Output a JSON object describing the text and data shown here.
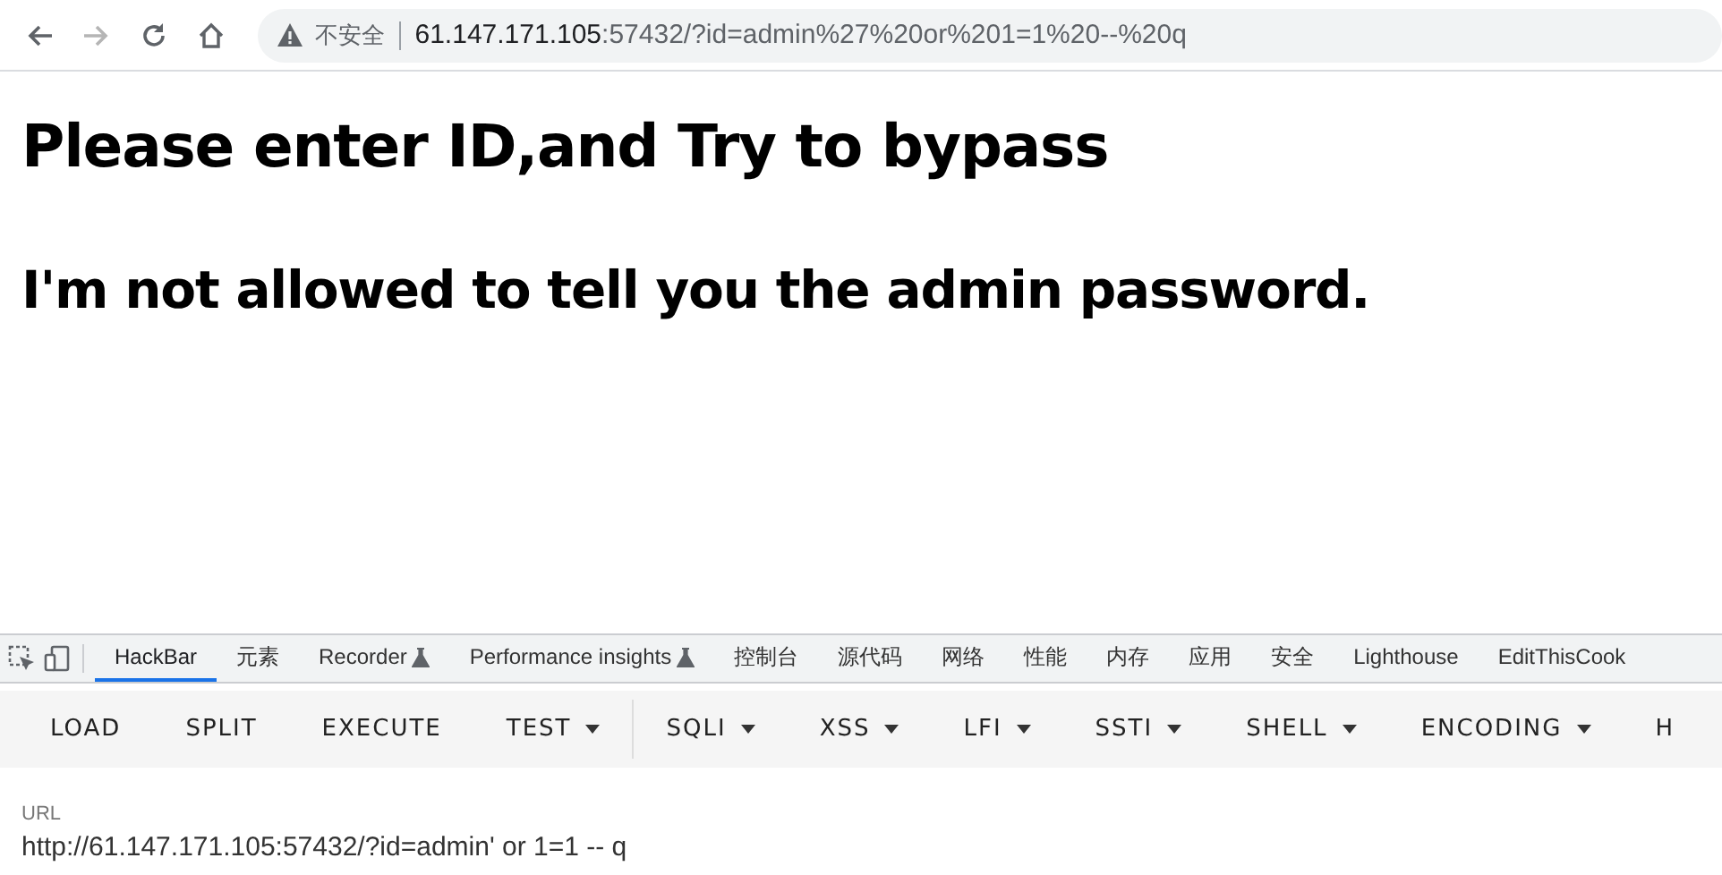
{
  "browser": {
    "security_label": "不安全",
    "url_host": "61.147.171.105",
    "url_rest": ":57432/?id=admin%27%20or%201=1%20--%20q"
  },
  "page": {
    "headings": [
      {
        "kind": "title",
        "text": "Please enter ID,and Try to bypass"
      },
      {
        "kind": "subtitle",
        "text": "I'm not allowed to tell you the admin password."
      }
    ]
  },
  "devtools": {
    "tabs": [
      {
        "label": "HackBar",
        "selected": true,
        "flask": false
      },
      {
        "label": "元素",
        "selected": false,
        "flask": false
      },
      {
        "label": "Recorder",
        "selected": false,
        "flask": true
      },
      {
        "label": "Performance insights",
        "selected": false,
        "flask": true
      },
      {
        "label": "控制台",
        "selected": false,
        "flask": false
      },
      {
        "label": "源代码",
        "selected": false,
        "flask": false
      },
      {
        "label": "网络",
        "selected": false,
        "flask": false
      },
      {
        "label": "性能",
        "selected": false,
        "flask": false
      },
      {
        "label": "内存",
        "selected": false,
        "flask": false
      },
      {
        "label": "应用",
        "selected": false,
        "flask": false
      },
      {
        "label": "安全",
        "selected": false,
        "flask": false
      },
      {
        "label": "Lighthouse",
        "selected": false,
        "flask": false
      },
      {
        "label": "EditThisCook",
        "selected": false,
        "flask": false
      }
    ]
  },
  "hackbar": {
    "buttons": [
      {
        "kind": "button",
        "label": "LOAD",
        "menu": false
      },
      {
        "kind": "button",
        "label": "SPLIT",
        "menu": false
      },
      {
        "kind": "button",
        "label": "EXECUTE",
        "menu": false
      },
      {
        "kind": "button",
        "label": "TEST",
        "menu": true
      },
      {
        "kind": "divider"
      },
      {
        "kind": "button",
        "label": "SQLI",
        "menu": true
      },
      {
        "kind": "button",
        "label": "XSS",
        "menu": true
      },
      {
        "kind": "button",
        "label": "LFI",
        "menu": true
      },
      {
        "kind": "button",
        "label": "SSTI",
        "menu": true
      },
      {
        "kind": "button",
        "label": "SHELL",
        "menu": true
      },
      {
        "kind": "button",
        "label": "ENCODING",
        "menu": true
      },
      {
        "kind": "button",
        "label": "H",
        "menu": false
      }
    ],
    "url_label": "URL",
    "url_value": "http://61.147.171.105:57432/?id=admin' or 1=1 -- q"
  }
}
